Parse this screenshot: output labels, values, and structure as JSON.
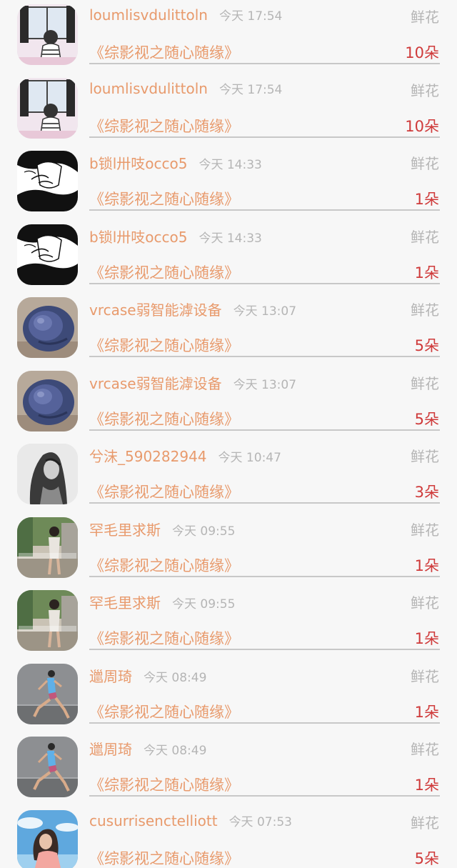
{
  "records": [
    {
      "name": "loumlisvdulittoln",
      "time": "今天 17:54",
      "kind": "鲜花",
      "title": "《综影视之随心随缘》",
      "count": "10朵",
      "avatar": "window-icon"
    },
    {
      "name": "loumlisvdulittoln",
      "time": "今天 17:54",
      "kind": "鲜花",
      "title": "《综影视之随心随缘》",
      "count": "10朵",
      "avatar": "window-icon"
    },
    {
      "name": "b锁l卅吱occo5",
      "time": "今天 14:33",
      "kind": "鲜花",
      "title": "《综影视之随心随缘》",
      "count": "1朵",
      "avatar": "sketch-icon"
    },
    {
      "name": "b锁l卅吱occo5",
      "time": "今天 14:33",
      "kind": "鲜花",
      "title": "《综影视之随心随缘》",
      "count": "1朵",
      "avatar": "sketch-icon"
    },
    {
      "name": "vrcase弱智能滹设备",
      "time": "今天 13:07",
      "kind": "鲜花",
      "title": "《综影视之随心随缘》",
      "count": "5朵",
      "avatar": "shell-icon"
    },
    {
      "name": "vrcase弱智能滹设备",
      "time": "今天 13:07",
      "kind": "鲜花",
      "title": "《综影视之随心随缘》",
      "count": "5朵",
      "avatar": "shell-icon"
    },
    {
      "name": "兮沫_590282944",
      "time": "今天 10:47",
      "kind": "鲜花",
      "title": "《综影视之随心随缘》",
      "count": "3朵",
      "avatar": "portrait-icon"
    },
    {
      "name": "罕毛里求斯",
      "time": "今天 09:55",
      "kind": "鲜花",
      "title": "《综影视之随心随缘》",
      "count": "1朵",
      "avatar": "street-icon"
    },
    {
      "name": "罕毛里求斯",
      "time": "今天 09:55",
      "kind": "鲜花",
      "title": "《综影视之随心随缘》",
      "count": "1朵",
      "avatar": "street-icon"
    },
    {
      "name": "邋周琦",
      "time": "今天 08:49",
      "kind": "鲜花",
      "title": "《综影视之随心随缘》",
      "count": "1朵",
      "avatar": "runner-icon"
    },
    {
      "name": "邋周琦",
      "time": "今天 08:49",
      "kind": "鲜花",
      "title": "《综影视之随心随缘》",
      "count": "1朵",
      "avatar": "runner-icon"
    },
    {
      "name": "cusurrisenctelliott",
      "time": "今天 07:53",
      "kind": "鲜花",
      "title": "《综影视之随心随缘》",
      "count": "5朵",
      "avatar": "girl-sky-icon"
    }
  ],
  "colors": {
    "accent": "#e89a6c",
    "count": "#cf3a3a",
    "muted": "#b5b5b5",
    "divider": "#c8c8c8",
    "background": "#f7f7f7"
  }
}
